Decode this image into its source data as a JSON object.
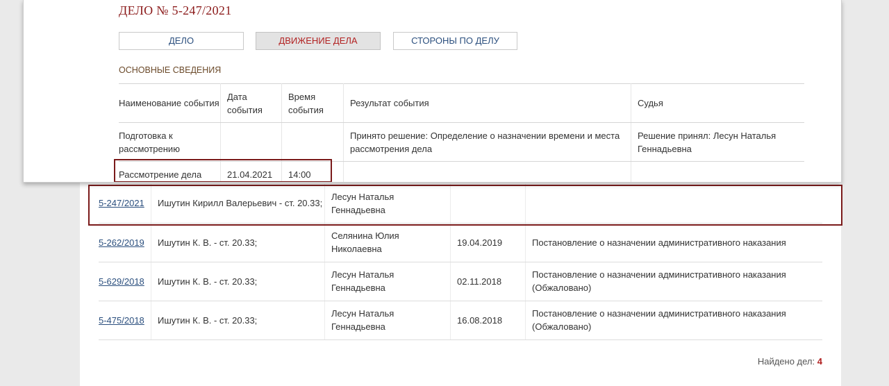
{
  "case_list": {
    "rows": [
      {
        "case_number": "5-247/2021",
        "defendant": "Ишутин Кирилл Валерьевич - ст. 20.33;",
        "judge": "Лесун Наталья Геннадьевна",
        "date": "",
        "result": ""
      },
      {
        "case_number": "5-262/2019",
        "defendant": "Ишутин К. В. - ст. 20.33;",
        "judge": "Селянина Юлия Николаевна",
        "date": "19.04.2019",
        "result": "Постановление о назначении административного наказания"
      },
      {
        "case_number": "5-629/2018",
        "defendant": "Ишутин К. В. - ст. 20.33;",
        "judge": "Лесун Наталья Геннадьевна",
        "date": "02.11.2018",
        "result": "Постановление о назначении административного наказания (Обжаловано)"
      },
      {
        "case_number": "5-475/2018",
        "defendant": "Ишутин К. В. - ст. 20.33;",
        "judge": "Лесун Наталья Геннадьевна",
        "date": "16.08.2018",
        "result": "Постановление о назначении административного наказания (Обжаловано)"
      }
    ],
    "found_label": "Найдено дел:",
    "found_count": "4"
  },
  "popup": {
    "title": "ДЕЛО № 5-247/2021",
    "tabs": [
      {
        "label": "ДЕЛО",
        "active": false
      },
      {
        "label": "ДВИЖЕНИЕ ДЕЛА",
        "active": true
      },
      {
        "label": "СТОРОНЫ ПО ДЕЛУ",
        "active": false
      }
    ],
    "section_title": "ОСНОВНЫЕ СВЕДЕНИЯ",
    "headers": [
      "Наименование события",
      "Дата события",
      "Время события",
      "Результат события",
      "Судья"
    ],
    "events": [
      {
        "name": "Подготовка к рассмотрению",
        "date": "",
        "time": "",
        "result": "Принято решение: Определение о назначении времени и места рассмотрения дела",
        "judge": "Решение принял: Лесун Наталья Геннадьевна"
      },
      {
        "name": "Рассмотрение дела",
        "date": "21.04.2021",
        "time": "14:00",
        "result": "",
        "judge": ""
      }
    ]
  },
  "colors": {
    "accent_red": "#8b1a1a",
    "highlight_box": "#7a1a1a",
    "link": "#2b4f7e"
  }
}
